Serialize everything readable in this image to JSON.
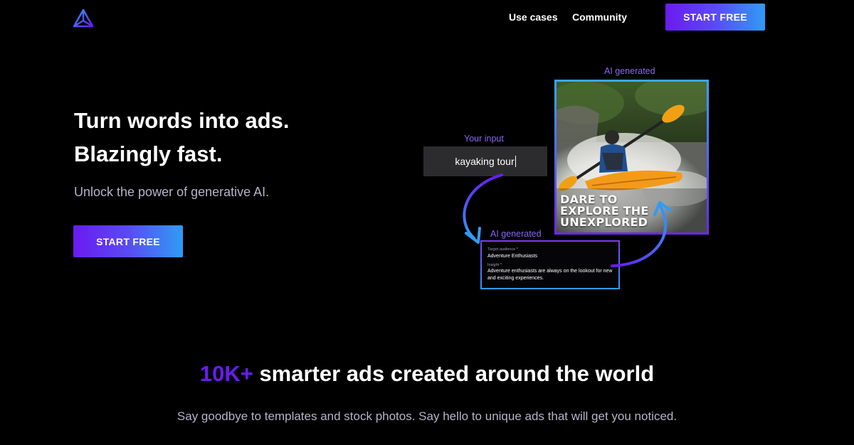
{
  "nav": {
    "logo_icon": "triangle-logo-icon",
    "links": [
      "Use cases",
      "Community"
    ],
    "cta_label": "START FREE"
  },
  "hero": {
    "title_line1": "Turn words into ads.",
    "title_line2": "Blazingly fast.",
    "subtitle": "Unlock the power of generative AI.",
    "cta_label": "START FREE"
  },
  "demo": {
    "input_label": "Your input",
    "input_value": "kayaking tour",
    "image_label": "AI generated",
    "image_headline": [
      "DARE TO",
      "EXPLORE THE",
      "UNEXPLORED"
    ],
    "card_label": "AI generated",
    "card": {
      "audience_caption": "Target audience *",
      "audience_value": "Adventure Enthusiasts",
      "insight_caption": "Insight *",
      "insight_value": "Adventure enthusiasts are always on the lookout for new and exciting experiences."
    }
  },
  "stats": {
    "accent": "10K+",
    "title_rest": " smarter ads created around the world",
    "subtitle": "Say goodbye to templates and stock photos. Say hello to unique ads that will get you noticed."
  },
  "colors": {
    "background": "#000000",
    "accent_purple": "#6a1bf0",
    "accent_blue": "#2f9cf5",
    "muted_text": "#b7b3c9"
  }
}
